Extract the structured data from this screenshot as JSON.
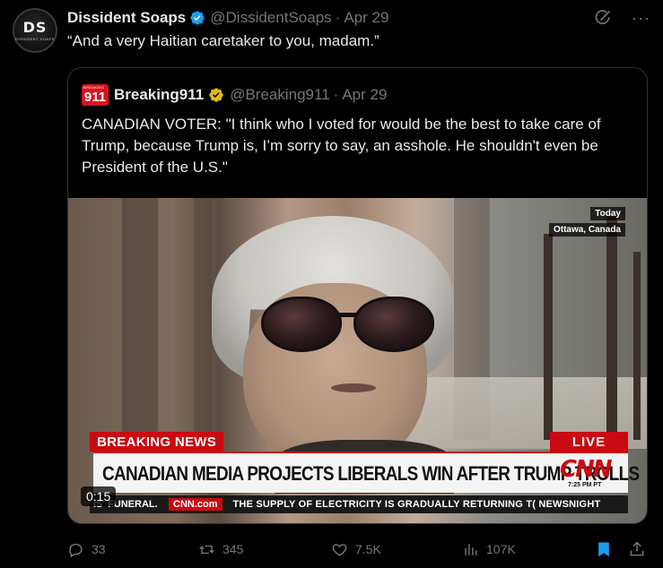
{
  "author": {
    "avatar_text": "DS",
    "avatar_subtext": "DISSIDENT SOAPS",
    "name": "Dissident Soaps",
    "handle": "@DissidentSoaps",
    "separator": "·",
    "date": "Apr 29",
    "verified_color": "#1d9bf0"
  },
  "tweet": {
    "text": "“And a very Haitian caretaker to you, madam.”"
  },
  "top_icons": [
    "grok-icon",
    "more-icon"
  ],
  "more_glyph": "···",
  "quote": {
    "avatar_text": "911",
    "avatar_tiny": "BREAKING",
    "name": "Breaking911",
    "handle": "@Breaking911",
    "separator": "·",
    "date": "Apr 29",
    "verified_color": "#e2b719",
    "text": "CANADIAN VOTER: \"I think who I voted for would be the best to take care of Trump, because Trump is, I’m sorry to say, an asshole. He shouldn't even be President of the U.S.\""
  },
  "video": {
    "dateline_top": "Today",
    "dateline_place": "Ottawa, Canada",
    "breaking_label": "BREAKING NEWS",
    "live_label": "LIVE",
    "headline": "CANADIAN MEDIA PROJECTS LIBERALS WIN AFTER TRUMP TROLLS",
    "network_logo": "CNN",
    "time": "7:25 PM PT",
    "ticker_left": "IS' FUNERAL.",
    "ticker_logo": "CNN.com",
    "ticker_main": "THE SUPPLY OF ELECTRICITY IS GRADUALLY RETURNING T( NEWSNIGHT",
    "timer": "0:15",
    "accent": "#c90a12"
  },
  "actions": {
    "replies": "33",
    "reposts": "345",
    "likes": "7.5K",
    "views": "107K",
    "bookmark_color": "#1d9bf0"
  }
}
